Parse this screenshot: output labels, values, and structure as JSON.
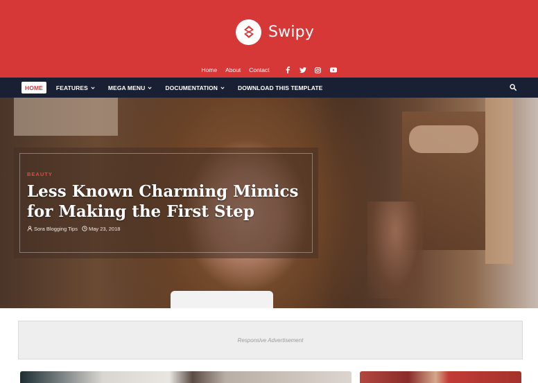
{
  "brand": {
    "name": "Swipy",
    "colors": {
      "primary": "#d63838",
      "nav": "#1a2033",
      "label": "#e04a45"
    }
  },
  "top_links": [
    {
      "label": "Home"
    },
    {
      "label": "About"
    },
    {
      "label": "Contact"
    }
  ],
  "social_icons": [
    "facebook-icon",
    "twitter-icon",
    "instagram-icon",
    "youtube-icon"
  ],
  "nav": {
    "items": [
      {
        "label": "HOME",
        "active": true,
        "dropdown": false
      },
      {
        "label": "FEATURES",
        "active": false,
        "dropdown": true
      },
      {
        "label": "MEGA MENU",
        "active": false,
        "dropdown": true
      },
      {
        "label": "DOCUMENTATION",
        "active": false,
        "dropdown": true
      },
      {
        "label": "DOWNLOAD THIS TEMPLATE",
        "active": false,
        "dropdown": false
      }
    ],
    "search_icon": "search-icon"
  },
  "hero": {
    "category": "BEAUTY",
    "title": "Less Known Charming Mimics for Making the First Step",
    "author": "Sora Blogging Tips",
    "date": "May 23, 2018"
  },
  "ad": {
    "text": "Responsive Advertisement"
  }
}
